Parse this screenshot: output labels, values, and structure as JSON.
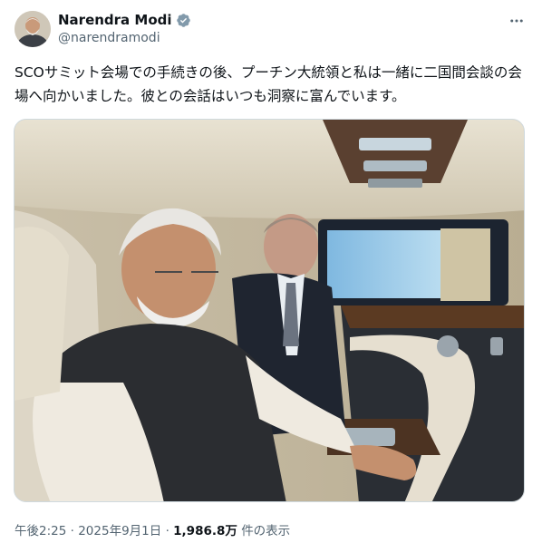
{
  "author": {
    "display_name": "Narendra Modi",
    "handle": "@narendramodi",
    "verified": true,
    "avatar_icon": "profile-photo",
    "more_icon": "more-horizontal-icon"
  },
  "tweet": {
    "text": "SCOサミット会場での手続きの後、プーチン大統領と私は一緒に二国間会談の会場へ向かいました。彼との会話はいつも洞察に富んでいます。",
    "media_type": "photo"
  },
  "meta": {
    "time": "午後2:25",
    "separator": "·",
    "date": "2025年9月1日",
    "views_count": "1,986.8万",
    "views_label": "件の表示"
  },
  "colors": {
    "text_primary": "#0f1419",
    "text_secondary": "#536471",
    "verified_badge": "#829aab",
    "border": "#cfd9de"
  }
}
